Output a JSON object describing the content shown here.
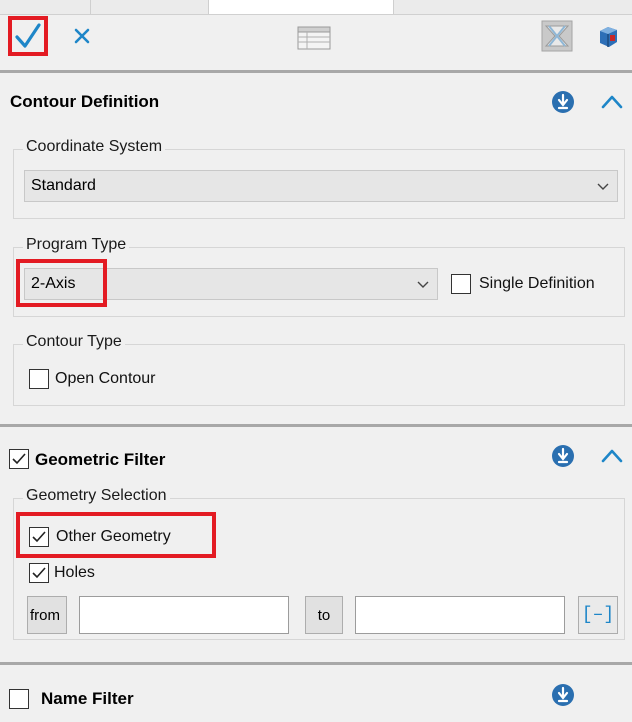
{
  "toolbar": {
    "ok_icon": "checkmark-icon",
    "cancel_icon": "close-icon",
    "table_icon": "table-icon",
    "filter_icon": "filter-icon",
    "cube_icon": "cube-icon"
  },
  "contour_definition": {
    "title": "Contour Definition",
    "coordinate_system": {
      "label": "Coordinate System",
      "value": "Standard"
    },
    "program_type": {
      "label": "Program Type",
      "value": "2-Axis",
      "single_definition_label": "Single Definition",
      "single_definition_checked": false
    },
    "contour_type": {
      "label": "Contour Type",
      "open_contour_label": "Open Contour",
      "open_contour_checked": false
    }
  },
  "geometric_filter": {
    "title": "Geometric Filter",
    "checked": true,
    "geometry_selection": {
      "label": "Geometry Selection",
      "other_geometry_label": "Other Geometry",
      "other_geometry_checked": true,
      "holes_label": "Holes",
      "holes_checked": true
    },
    "from_label": "from",
    "from_value": "",
    "to_label": "to",
    "to_value": "",
    "range_button_label": "[–]"
  },
  "name_filter": {
    "title": "Name Filter",
    "checked": false
  },
  "colors": {
    "accent_blue": "#1e86c8",
    "highlight_red": "#e31b23",
    "pin_blue": "#2a6fb0"
  }
}
